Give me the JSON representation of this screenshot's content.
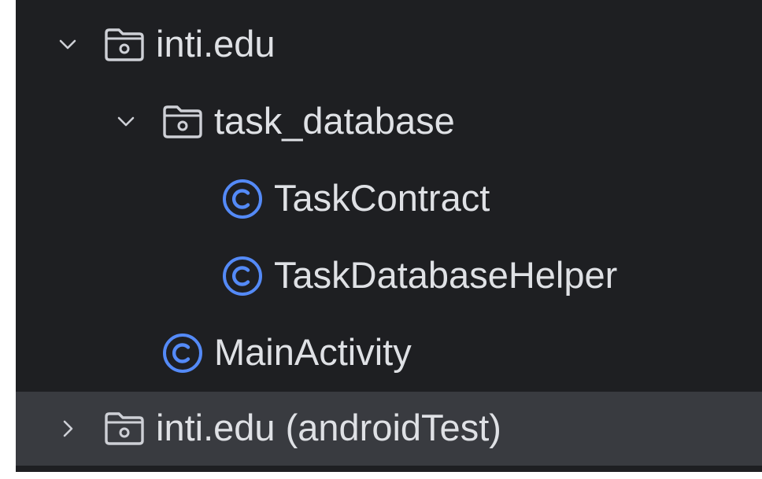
{
  "tree": {
    "items": [
      {
        "label": "inti.edu",
        "icon": "package-folder-icon",
        "expanded": true
      },
      {
        "label": "task_database",
        "icon": "package-folder-icon",
        "expanded": true
      },
      {
        "label": "TaskContract",
        "icon": "class-icon"
      },
      {
        "label": "TaskDatabaseHelper",
        "icon": "class-icon"
      },
      {
        "label": "MainActivity",
        "icon": "class-icon"
      },
      {
        "label": "inti.edu (androidTest)",
        "icon": "package-folder-icon",
        "expanded": false,
        "selected": true
      }
    ]
  },
  "colors": {
    "panel_bg": "#1e1f22",
    "selected_row_bg": "#393b40",
    "text": "#dfe1e5",
    "class_icon": "#548af7",
    "folder_icon": "#ced0d6"
  }
}
